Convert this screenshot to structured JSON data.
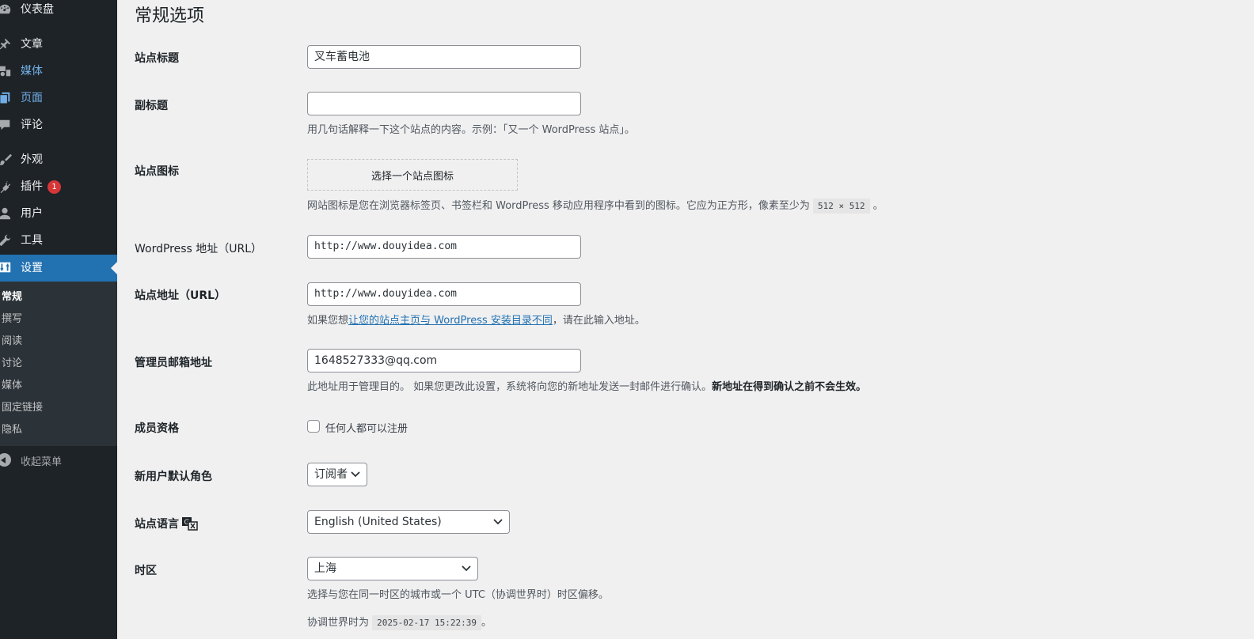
{
  "sidebar": {
    "items": [
      {
        "label": "仪表盘",
        "icon": "dashboard-icon"
      },
      {
        "label": "文章",
        "icon": "pin-icon"
      },
      {
        "label": "媒体",
        "icon": "media-icon"
      },
      {
        "label": "页面",
        "icon": "pages-icon"
      },
      {
        "label": "评论",
        "icon": "comment-icon"
      },
      {
        "label": "外观",
        "icon": "brush-icon"
      },
      {
        "label": "插件",
        "icon": "plugin-icon",
        "badge": "1"
      },
      {
        "label": "用户",
        "icon": "user-icon"
      },
      {
        "label": "工具",
        "icon": "wrench-icon"
      },
      {
        "label": "设置",
        "icon": "settings-icon"
      }
    ],
    "submenu": [
      "常规",
      "撰写",
      "阅读",
      "讨论",
      "媒体",
      "固定链接",
      "隐私"
    ],
    "collapse_label": "收起菜单"
  },
  "page": {
    "title": "常规选项",
    "site_title": {
      "label": "站点标题",
      "value": "叉车蓄电池"
    },
    "tagline": {
      "label": "副标题",
      "value": "",
      "desc": "用几句话解释一下这个站点的内容。示例：「又一个 WordPress 站点」。"
    },
    "site_icon": {
      "label": "站点图标",
      "button": "选择一个站点图标",
      "desc_pre": "网站图标是您在浏览器标签页、书签栏和 WordPress 移动应用程序中看到的图标。它应为正方形，像素至少为",
      "size": "512 × 512",
      "desc_post": "。"
    },
    "wp_url": {
      "label": "WordPress 地址（URL）",
      "value": "http://www.douyidea.com"
    },
    "site_url": {
      "label": "站点地址（URL）",
      "value": "http://www.douyidea.com",
      "desc_pre": "如果您想",
      "desc_link": "让您的站点主页与 WordPress 安装目录不同",
      "desc_post": "，请在此输入地址。"
    },
    "admin_email": {
      "label": "管理员邮箱地址",
      "value": "1648527333@qq.com",
      "desc": "此地址用于管理目的。 如果您更改此设置，系统将向您的新地址发送一封邮件进行确认。",
      "desc_bold": "新地址在得到确认之前不会生效。"
    },
    "membership": {
      "label": "成员资格",
      "checkbox_label": "任何人都可以注册",
      "checked": false
    },
    "default_role": {
      "label": "新用户默认角色",
      "value": "订阅者"
    },
    "language": {
      "label": "站点语言",
      "value": "English (United States)"
    },
    "timezone": {
      "label": "时区",
      "value": "上海",
      "desc": "选择与您在同一时区的城市或一个 UTC（协调世界时）时区偏移。",
      "utc_pre": "协调世界时为",
      "utc_time": "2025-02-17 15:22:39",
      "utc_post": "。"
    }
  },
  "colors": {
    "sidebar_bg": "#1d2327",
    "submenu_bg": "#2c3338",
    "accent": "#2271b1",
    "link_highlight": "#72aee6",
    "badge": "#d63638",
    "page_bg": "#f0f0f1"
  }
}
